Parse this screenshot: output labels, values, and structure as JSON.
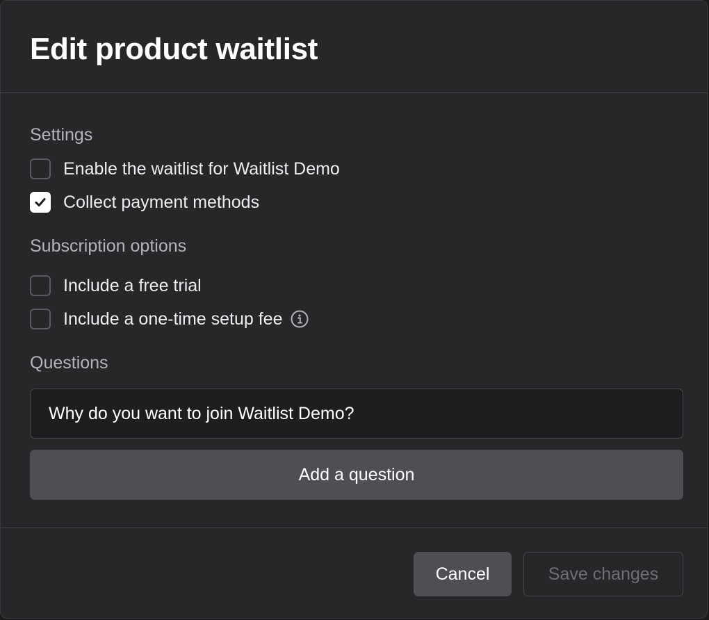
{
  "dialog": {
    "title": "Edit product waitlist"
  },
  "settings": {
    "label": "Settings",
    "options": [
      {
        "label": "Enable the waitlist for Waitlist Demo",
        "checked": false
      },
      {
        "label": "Collect payment methods",
        "checked": true
      }
    ]
  },
  "subscription": {
    "label": "Subscription options",
    "options": [
      {
        "label": "Include a free trial",
        "checked": false
      },
      {
        "label": "Include a one-time setup fee",
        "checked": false,
        "icon": "info-icon"
      }
    ]
  },
  "questions": {
    "label": "Questions",
    "items": [
      {
        "value": "Why do you want to join Waitlist Demo?"
      }
    ],
    "add_label": "Add a question"
  },
  "footer": {
    "cancel_label": "Cancel",
    "save_label": "Save changes",
    "save_disabled": true
  },
  "colors": {
    "dialog_bg": "#27272a",
    "divider": "#46464a",
    "button_bg": "#4e4e54",
    "input_bg": "#1e1e20",
    "text_primary": "#ffffff",
    "text_secondary": "#b4b4b8",
    "text_disabled": "#6e6e73"
  }
}
